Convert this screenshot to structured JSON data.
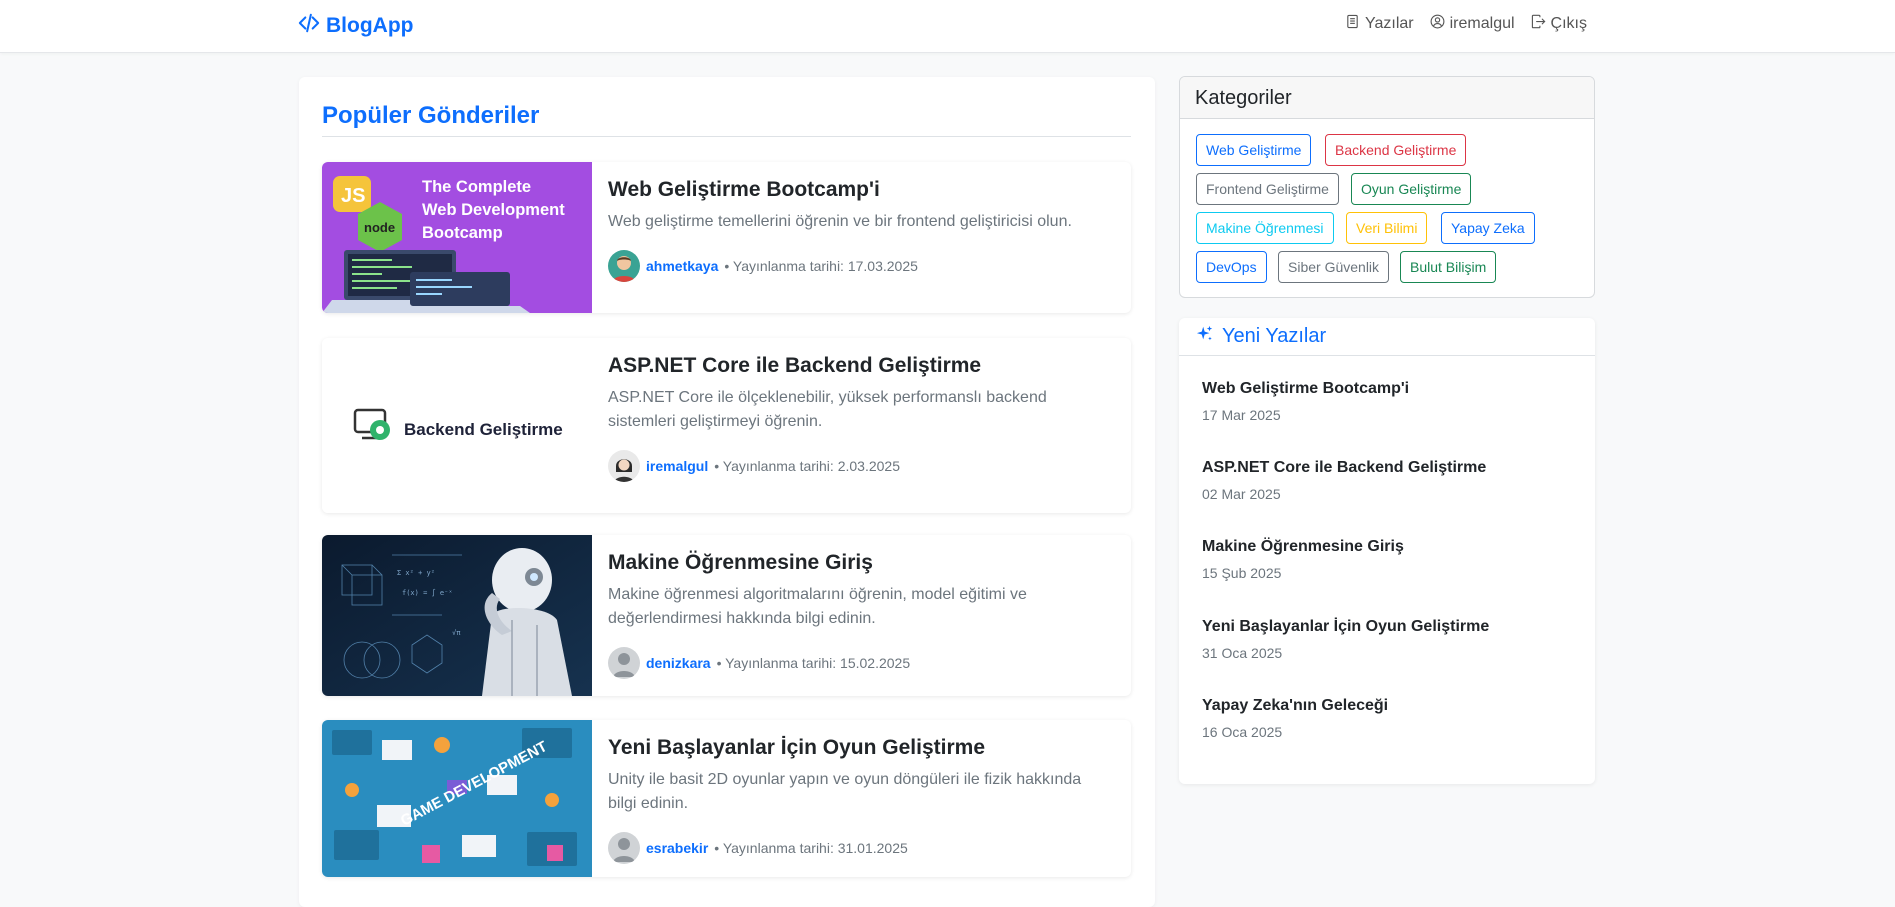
{
  "nav": {
    "brand": "BlogApp",
    "links": [
      {
        "label": "Yazılar",
        "icon": "file-text-icon"
      },
      {
        "label": "iremalgul",
        "icon": "user-circle-icon"
      },
      {
        "label": "Çıkış",
        "icon": "logout-icon"
      }
    ]
  },
  "main": {
    "title": "Popüler Gönderiler",
    "posts": [
      {
        "title": "Web Geliştirme Bootcamp'i",
        "description": "Web geliştirme temellerini öğrenin ve bir frontend geliştiricisi olun.",
        "author": "ahmetkaya",
        "meta": "• Yayınlanma tarihi: 17.03.2025",
        "thumb": {
          "badge": "JS",
          "logo": "node",
          "lines": [
            "The Complete",
            "Web Development",
            "Bootcamp"
          ]
        }
      },
      {
        "title": "ASP.NET Core ile Backend Geliştirme",
        "description": "ASP.NET Core ile ölçeklenebilir, yüksek performanslı backend sistemleri geliştirmeyi öğrenin.",
        "author": "iremalgul",
        "meta": "• Yayınlanma tarihi: 2.03.2025",
        "thumb": {
          "label": "Backend Geliştirme"
        }
      },
      {
        "title": "Makine Öğrenmesine Giriş",
        "description": "Makine öğrenmesi algoritmalarını öğrenin, model eğitimi ve değerlendirmesi hakkında bilgi edinin.",
        "author": "denizkara",
        "meta": "• Yayınlanma tarihi: 15.02.2025"
      },
      {
        "title": "Yeni Başlayanlar İçin Oyun Geliştirme",
        "description": "Unity ile basit 2D oyunlar yapın ve oyun döngüleri ile fizik hakkında bilgi edinin.",
        "author": "esrabekir",
        "meta": "• Yayınlanma tarihi: 31.01.2025",
        "thumb": {
          "label": "GAME DEVELOPMENT"
        }
      }
    ]
  },
  "categories": {
    "title": "Kategoriler",
    "items": [
      {
        "label": "Web Geliştirme",
        "color": "#0d6efd"
      },
      {
        "label": "Backend Geliştirme",
        "color": "#dc3545"
      },
      {
        "label": "Frontend Geliştirme",
        "color": "#6c757d"
      },
      {
        "label": "Oyun Geliştirme",
        "color": "#198754"
      },
      {
        "label": "Makine Öğrenmesi",
        "color": "#0dcaf0"
      },
      {
        "label": "Veri Bilimi",
        "color": "#ffc107"
      },
      {
        "label": "Yapay Zeka",
        "color": "#0d6efd"
      },
      {
        "label": "DevOps",
        "color": "#0d6efd"
      },
      {
        "label": "Siber Güvenlik",
        "color": "#6c757d"
      },
      {
        "label": "Bulut Bilişim",
        "color": "#198754"
      }
    ]
  },
  "recent": {
    "title": "Yeni Yazılar",
    "icon": "sparkles-icon",
    "items": [
      {
        "title": "Web Geliştirme Bootcamp'i",
        "date": "17 Mar 2025"
      },
      {
        "title": "ASP.NET Core ile Backend Geliştirme",
        "date": "02 Mar 2025"
      },
      {
        "title": "Makine Öğrenmesine Giriş",
        "date": "15 Şub 2025"
      },
      {
        "title": "Yeni Başlayanlar İçin Oyun Geliştirme",
        "date": "31 Oca 2025"
      },
      {
        "title": "Yapay Zeka'nın Geleceği",
        "date": "16 Oca 2025"
      }
    ]
  },
  "colors": {
    "primary": "#0d6efd",
    "background": "#f8f9fa"
  }
}
